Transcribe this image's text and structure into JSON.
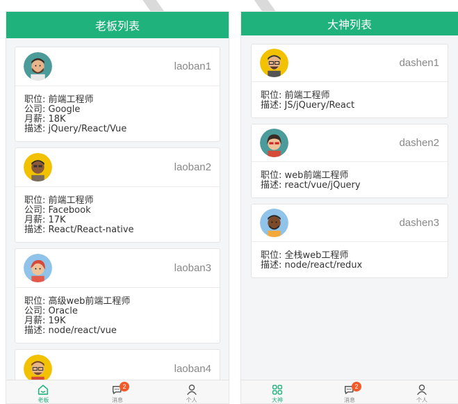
{
  "colors": {
    "brand": "#20b27c",
    "badge": "#f25a2a"
  },
  "left": {
    "title": "老板列表",
    "cards": [
      {
        "username": "laoban1",
        "avatar": "avatar-teal-bearded",
        "lines": [
          "职位: 前端工程师",
          "公司: Google",
          "月薪: 18K",
          "描述: jQuery/React/Vue"
        ]
      },
      {
        "username": "laoban2",
        "avatar": "avatar-yellow-dark",
        "lines": [
          "职位: 前端工程师",
          "公司: Facebook",
          "月薪: 17K",
          "描述: React/React-native"
        ]
      },
      {
        "username": "laoban3",
        "avatar": "avatar-blue-red-hair",
        "lines": [
          "职位: 高级web前端工程师",
          "公司: Oracle",
          "月薪: 19K",
          "描述: node/react/vue"
        ]
      },
      {
        "username": "laoban4",
        "avatar": "avatar-yellow-glasses",
        "lines": []
      }
    ],
    "tabs": [
      {
        "label": "老板",
        "icon": "home-icon",
        "active": true
      },
      {
        "label": "消息",
        "icon": "chat-icon",
        "badge": "2"
      },
      {
        "label": "个人",
        "icon": "person-icon"
      }
    ]
  },
  "right": {
    "title": "大神列表",
    "cards": [
      {
        "username": "dashen1",
        "avatar": "avatar-yellow-glasses",
        "lines": [
          "职位: 前端工程师",
          "描述: JS/jQuery/React"
        ]
      },
      {
        "username": "dashen2",
        "avatar": "avatar-teal-red-woman",
        "lines": [
          "职位: web前端工程师",
          "描述: react/vue/jQuery"
        ]
      },
      {
        "username": "dashen3",
        "avatar": "avatar-blue-dark",
        "lines": [
          "职位: 全栈web工程师",
          "描述: node/react/redux"
        ]
      }
    ],
    "tabs": [
      {
        "label": "大神",
        "icon": "grid-icon",
        "active": true
      },
      {
        "label": "消息",
        "icon": "chat-icon",
        "badge": "2"
      },
      {
        "label": "个人",
        "icon": "person-icon"
      }
    ]
  }
}
